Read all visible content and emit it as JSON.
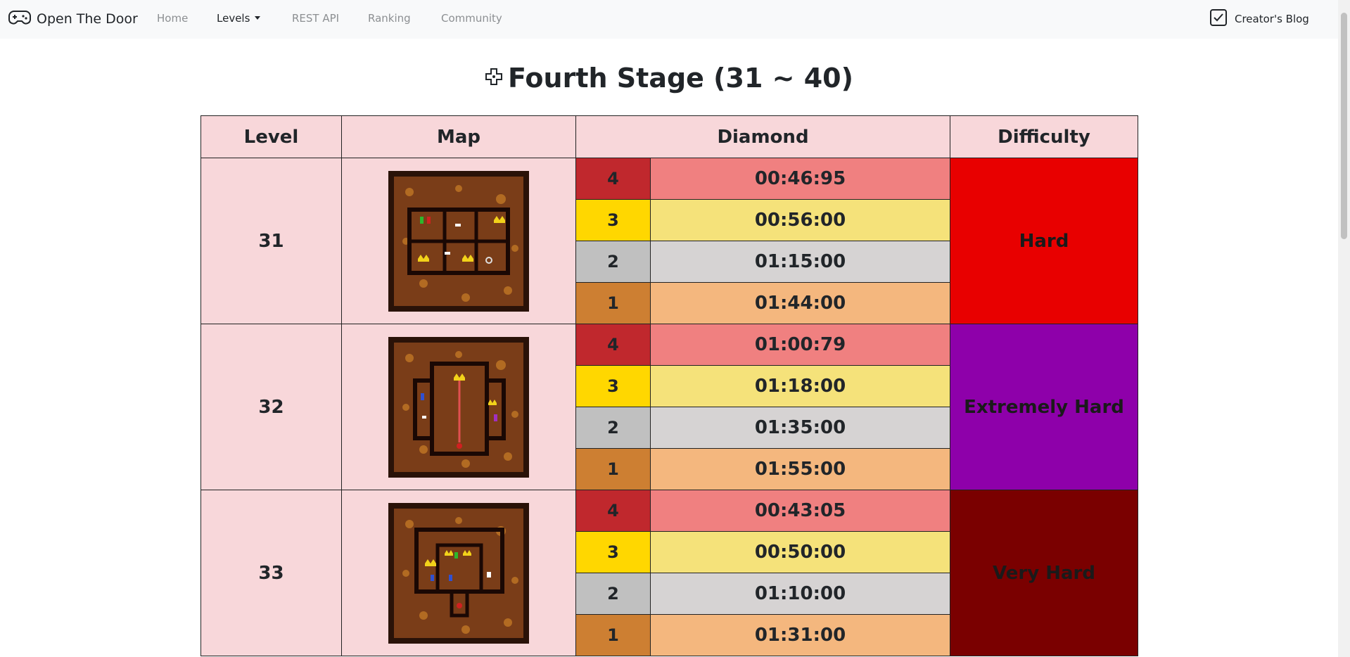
{
  "navbar": {
    "brand": "Open The Door",
    "links": {
      "home": "Home",
      "levels": "Levels",
      "rest_api": "REST API",
      "ranking": "Ranking",
      "community": "Community"
    },
    "blog": "Creator's Blog"
  },
  "page_title": "Fourth Stage (31 ~ 40)",
  "table": {
    "headers": {
      "level": "Level",
      "map": "Map",
      "diamond": "Diamond",
      "difficulty": "Difficulty"
    },
    "diamond_colors": {
      "4": {
        "badge": "#c0282d",
        "time": "#f08080"
      },
      "3": {
        "badge": "#ffd700",
        "time": "#f5e27a"
      },
      "2": {
        "badge": "#c0c0c0",
        "time": "#d6d3d3"
      },
      "1": {
        "badge": "#cd7f32",
        "time": "#f4b77e"
      }
    },
    "rows": [
      {
        "level": "31",
        "difficulty": "Hard",
        "difficulty_color": "#e80000",
        "diamonds": [
          {
            "count": "4",
            "time": "00:46:95"
          },
          {
            "count": "3",
            "time": "00:56:00"
          },
          {
            "count": "2",
            "time": "01:15:00"
          },
          {
            "count": "1",
            "time": "01:44:00"
          }
        ]
      },
      {
        "level": "32",
        "difficulty": "Extremely Hard",
        "difficulty_color": "#8e00aa",
        "diamonds": [
          {
            "count": "4",
            "time": "01:00:79"
          },
          {
            "count": "3",
            "time": "01:18:00"
          },
          {
            "count": "2",
            "time": "01:35:00"
          },
          {
            "count": "1",
            "time": "01:55:00"
          }
        ]
      },
      {
        "level": "33",
        "difficulty": "Very Hard",
        "difficulty_color": "#7a0000",
        "diamonds": [
          {
            "count": "4",
            "time": "00:43:05"
          },
          {
            "count": "3",
            "time": "00:50:00"
          },
          {
            "count": "2",
            "time": "01:10:00"
          },
          {
            "count": "1",
            "time": "01:31:00"
          }
        ]
      }
    ]
  }
}
